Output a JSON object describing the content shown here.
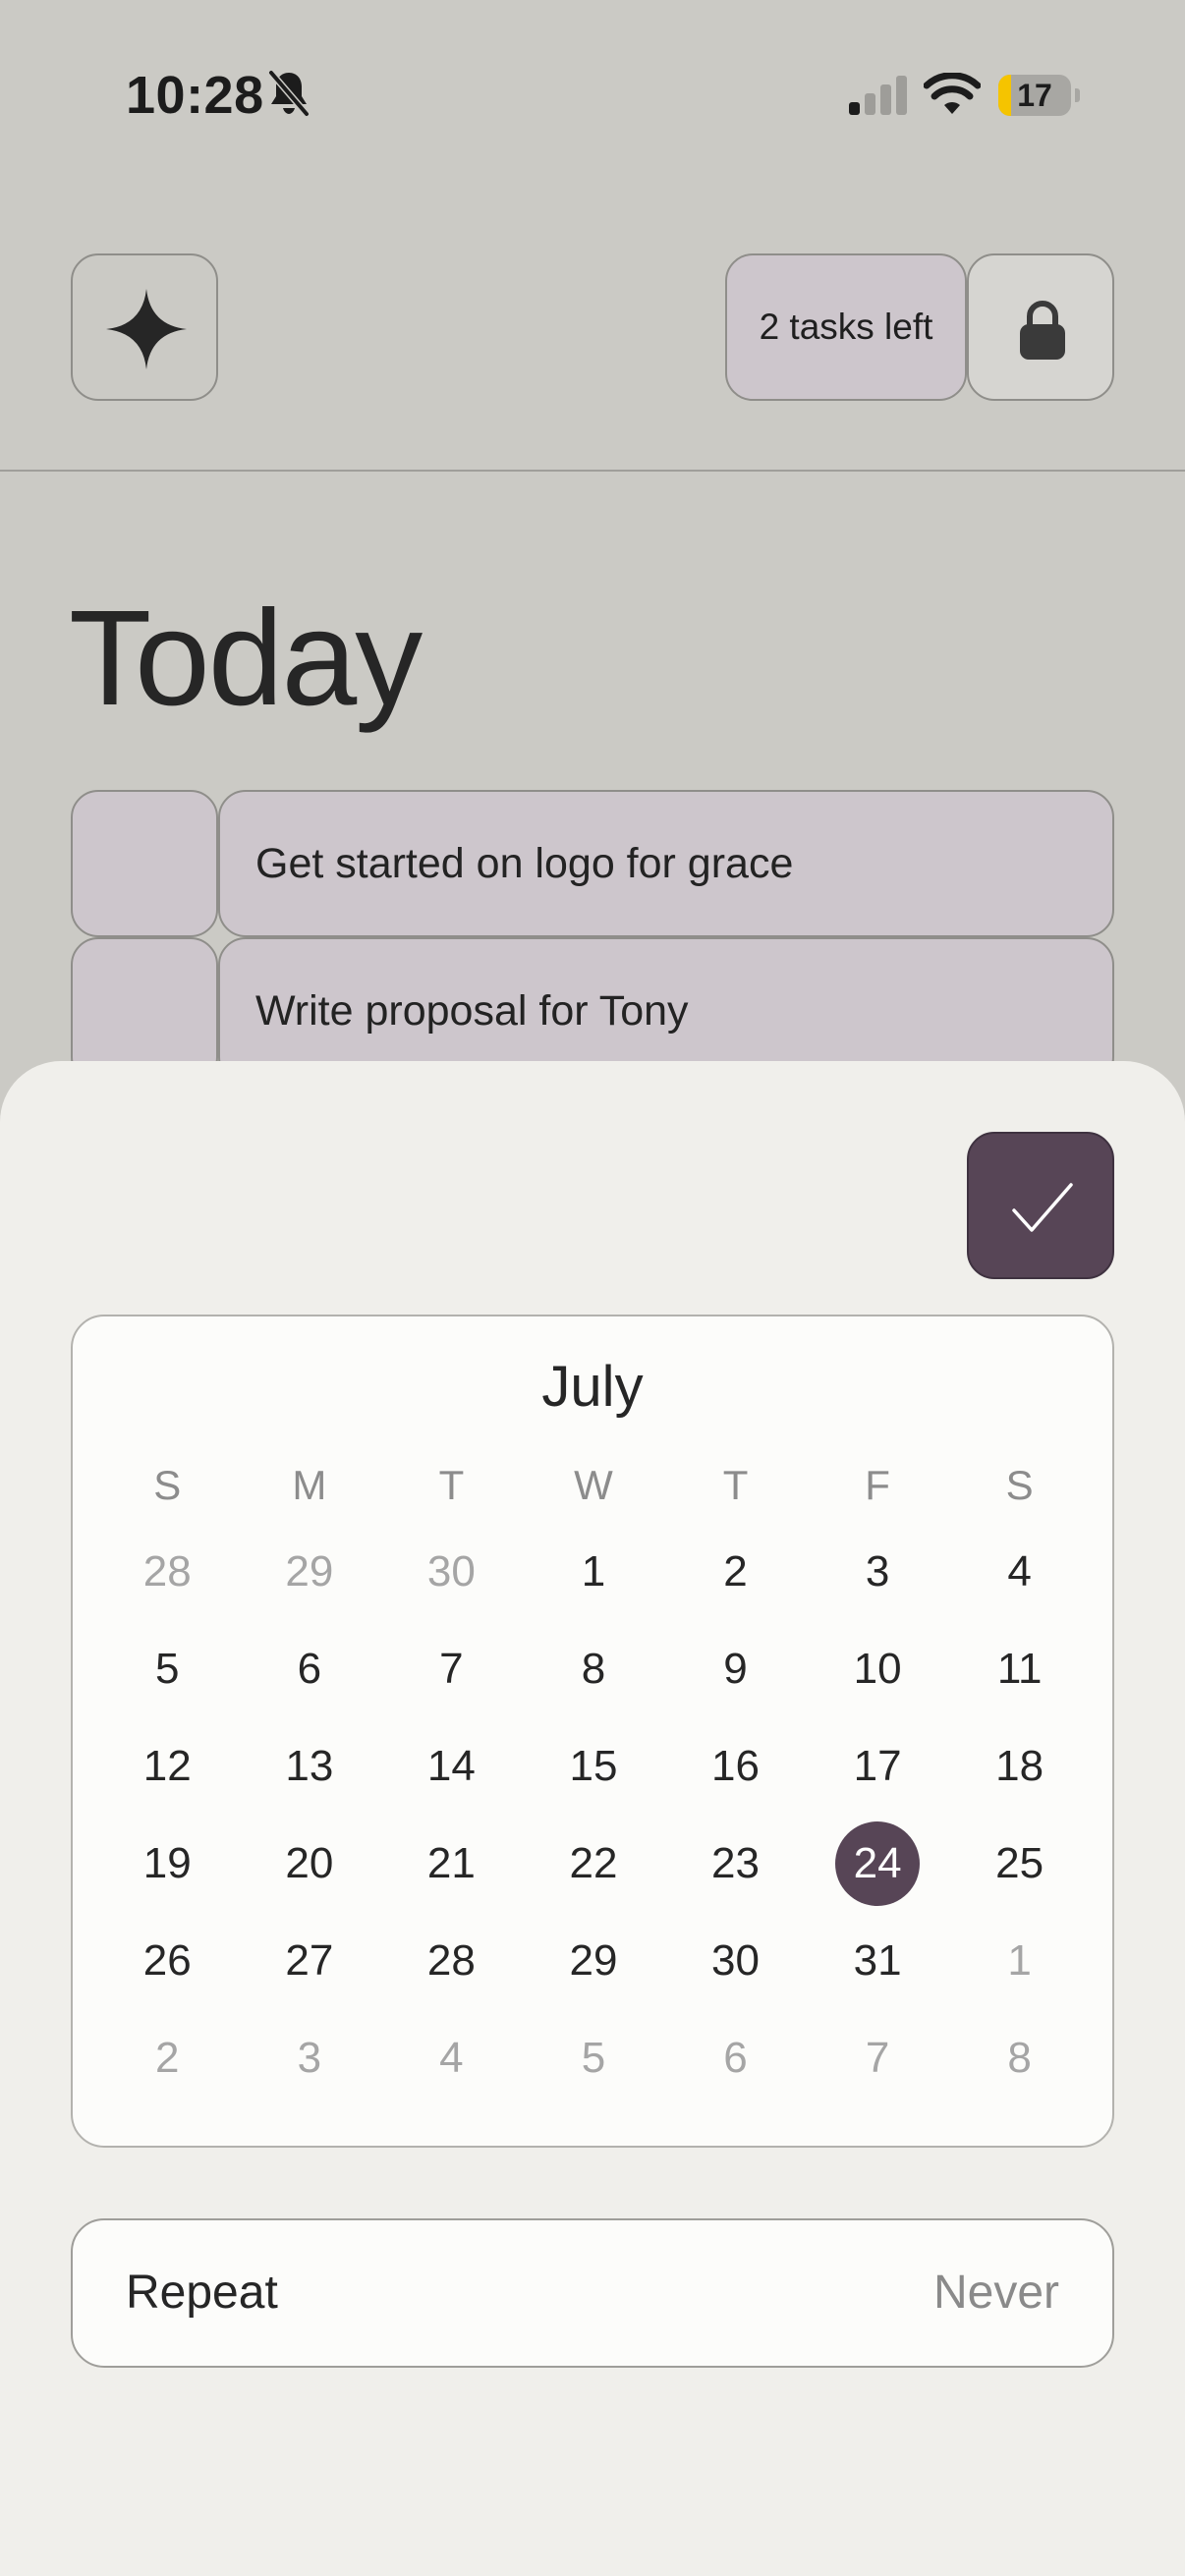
{
  "status_bar": {
    "time": "10:28",
    "battery_level": "17",
    "battery_fraction": 0.17,
    "icons": [
      "bell-slash-icon",
      "cellular-signal-icon",
      "wifi-icon",
      "battery-icon"
    ]
  },
  "header": {
    "sparkle_icon": "sparkle-icon",
    "tasks_left_label": "2 tasks left",
    "lock_icon": "lock-icon"
  },
  "today": {
    "title": "Today",
    "tasks": [
      {
        "text": "Get started on logo for grace"
      },
      {
        "text": "Write proposal for Tony"
      }
    ]
  },
  "date_sheet": {
    "confirm_icon": "checkmark-icon",
    "calendar": {
      "month": "July",
      "weekdays": [
        "S",
        "M",
        "T",
        "W",
        "T",
        "F",
        "S"
      ],
      "weeks": [
        [
          {
            "d": "28",
            "o": true
          },
          {
            "d": "29",
            "o": true
          },
          {
            "d": "30",
            "o": true
          },
          {
            "d": "1"
          },
          {
            "d": "2"
          },
          {
            "d": "3"
          },
          {
            "d": "4"
          }
        ],
        [
          {
            "d": "5"
          },
          {
            "d": "6"
          },
          {
            "d": "7"
          },
          {
            "d": "8"
          },
          {
            "d": "9"
          },
          {
            "d": "10"
          },
          {
            "d": "11"
          }
        ],
        [
          {
            "d": "12"
          },
          {
            "d": "13"
          },
          {
            "d": "14"
          },
          {
            "d": "15"
          },
          {
            "d": "16"
          },
          {
            "d": "17"
          },
          {
            "d": "18"
          }
        ],
        [
          {
            "d": "19"
          },
          {
            "d": "20"
          },
          {
            "d": "21"
          },
          {
            "d": "22"
          },
          {
            "d": "23"
          },
          {
            "d": "24",
            "selected": true
          },
          {
            "d": "25"
          }
        ],
        [
          {
            "d": "26"
          },
          {
            "d": "27"
          },
          {
            "d": "28"
          },
          {
            "d": "29"
          },
          {
            "d": "30"
          },
          {
            "d": "31"
          },
          {
            "d": "1",
            "o": true
          }
        ],
        [
          {
            "d": "2",
            "o": true
          },
          {
            "d": "3",
            "o": true
          },
          {
            "d": "4",
            "o": true
          },
          {
            "d": "5",
            "o": true
          },
          {
            "d": "6",
            "o": true
          },
          {
            "d": "7",
            "o": true
          },
          {
            "d": "8",
            "o": true
          }
        ]
      ],
      "selected_day": "24"
    },
    "repeat": {
      "label": "Repeat",
      "value": "Never"
    }
  },
  "colors": {
    "background": "#cbcac5",
    "task_fill": "#cdc6cc",
    "accent": "#574556",
    "sheet": "#f0efeb",
    "card": "#fcfcfa"
  }
}
